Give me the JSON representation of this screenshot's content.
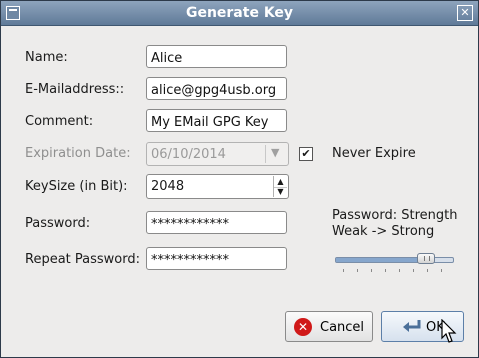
{
  "window": {
    "title": "Generate Key"
  },
  "form": {
    "name_label": "Name:",
    "name_value": "Alice",
    "email_label": "E-Mailaddress::",
    "email_value": "alice@gpg4usb.org",
    "comment_label": "Comment:",
    "comment_value": "My EMail GPG Key",
    "expiration_label": "Expiration Date:",
    "expiration_value": "06/10/2014",
    "never_expire_label": "Never Expire",
    "never_expire_checked": true,
    "keysize_label": "KeySize (in Bit):",
    "keysize_value": "2048",
    "password_label": "Password:",
    "password_value": "************",
    "repeat_password_label": "Repeat Password:",
    "repeat_password_value": "************"
  },
  "strength": {
    "line1": "Password: Strength",
    "line2": "Weak -> Strong",
    "level": 0.78
  },
  "buttons": {
    "cancel_label": "Cancel",
    "ok_label": "OK"
  },
  "colors": {
    "title_bar": "#6f88a4",
    "cancel_icon": "#d01919",
    "accent": "#5c7fa8"
  },
  "icons": {
    "window_menu": "window-menu-icon",
    "close": "close-icon",
    "cancel": "cancel-icon",
    "ok": "enter-arrow-icon",
    "pointer": "mouse-pointer-icon"
  }
}
